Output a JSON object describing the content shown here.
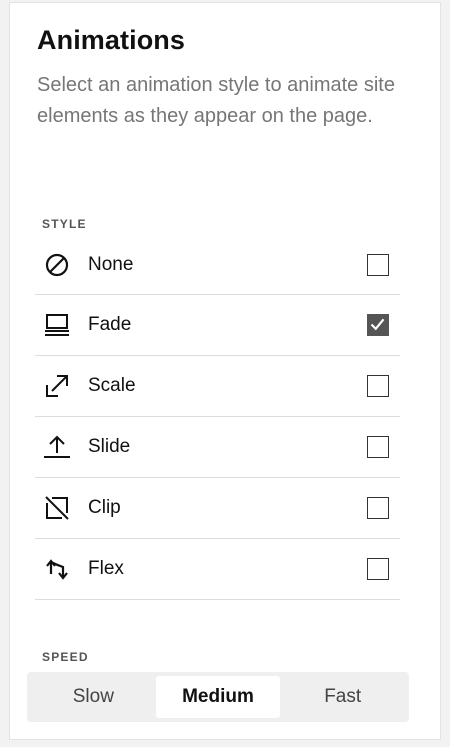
{
  "panel": {
    "title": "Animations",
    "description": "Select an animation style to animate site elements as they appear on the page."
  },
  "style_section": {
    "label": "STYLE",
    "options": [
      {
        "label": "None",
        "icon": "none-icon",
        "checked": false
      },
      {
        "label": "Fade",
        "icon": "fade-icon",
        "checked": true
      },
      {
        "label": "Scale",
        "icon": "scale-icon",
        "checked": false
      },
      {
        "label": "Slide",
        "icon": "slide-icon",
        "checked": false
      },
      {
        "label": "Clip",
        "icon": "clip-icon",
        "checked": false
      },
      {
        "label": "Flex",
        "icon": "flex-icon",
        "checked": false
      }
    ]
  },
  "speed_section": {
    "label": "SPEED",
    "options": [
      {
        "label": "Slow",
        "selected": false
      },
      {
        "label": "Medium",
        "selected": true
      },
      {
        "label": "Fast",
        "selected": false
      }
    ]
  },
  "colors": {
    "background": "#f2f2f2",
    "panel": "#ffffff",
    "text": "#111111",
    "muted_text": "#767676",
    "checkbox_checked": "#555555",
    "segment_bg": "#efefef"
  }
}
